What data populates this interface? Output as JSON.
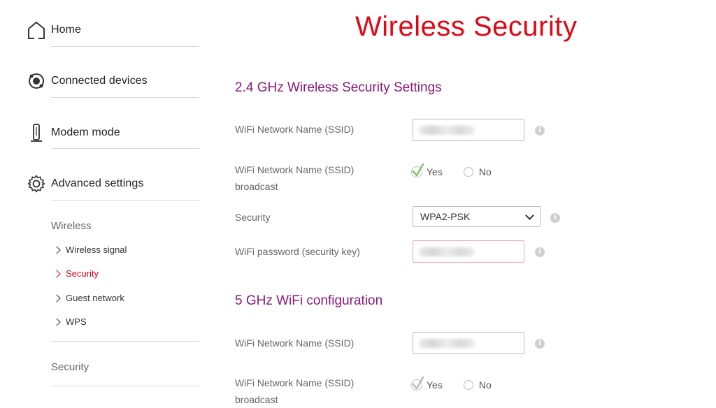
{
  "sidebar": {
    "items": [
      {
        "label": "Home",
        "icon": "home-icon"
      },
      {
        "label": "Connected devices",
        "icon": "devices-icon"
      },
      {
        "label": "Modem mode",
        "icon": "modem-icon"
      },
      {
        "label": "Advanced settings",
        "icon": "gear-icon"
      }
    ],
    "group_wireless": "Wireless",
    "sub_items": [
      "Wireless signal",
      "Security",
      "Guest network",
      "WPS"
    ],
    "active_sub_item": "Security",
    "group_security": "Security"
  },
  "main": {
    "title": "Wireless Security",
    "section_24": {
      "title": "2.4 GHz Wireless Security Settings",
      "ssid_label": "WiFi Network Name (SSID)",
      "broadcast_label": "WiFi Network Name (SSID) broadcast",
      "broadcast_yes": "Yes",
      "broadcast_no": "No",
      "broadcast_selected": "Yes",
      "security_label": "Security",
      "security_value": "WPA2-PSK",
      "password_label": "WiFi password (security key)"
    },
    "section_5": {
      "title": "5 GHz WiFi configuration",
      "ssid_label": "WiFi Network Name (SSID)",
      "broadcast_label": "WiFi Network Name (SSID) broadcast",
      "broadcast_yes": "Yes",
      "broadcast_no": "No",
      "broadcast_selected": "Yes"
    }
  },
  "colors": {
    "title": "#e30613",
    "section_title": "#8a1a7a",
    "active_link": "#e1001a",
    "check_24": "#7cc36b",
    "check_5": "#b8b8b8"
  }
}
